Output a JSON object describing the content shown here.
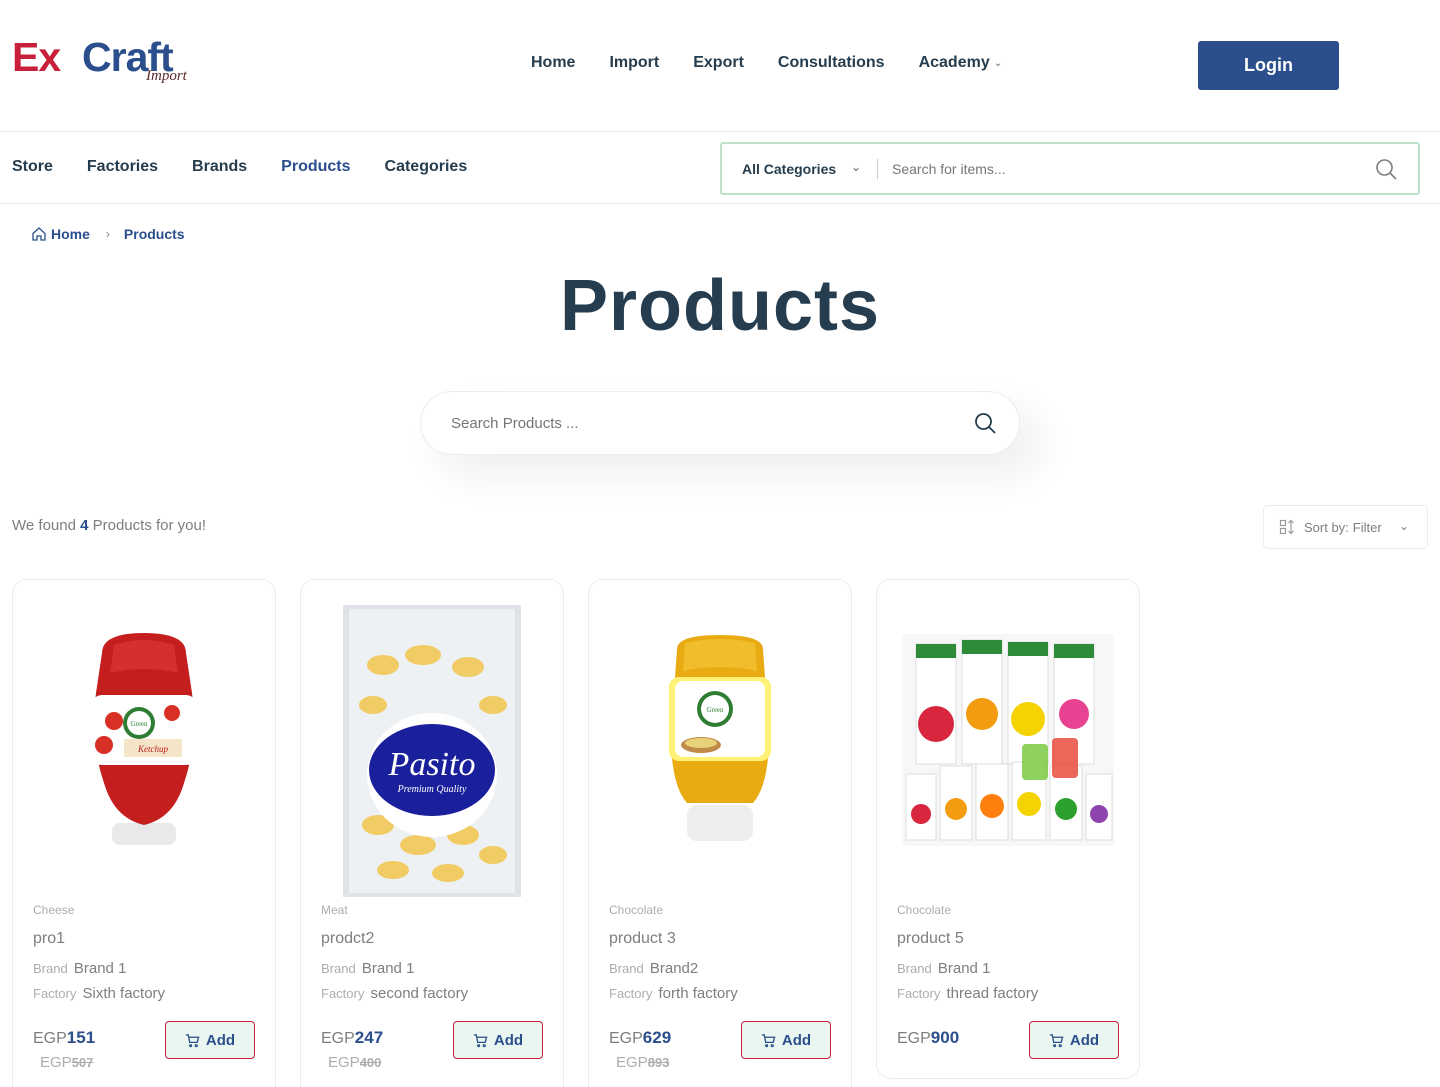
{
  "logo": {
    "ex": "Ex",
    "craft": "Craft",
    "sub": "Import"
  },
  "header": {
    "nav": [
      "Home",
      "Import",
      "Export",
      "Consultations",
      "Academy"
    ],
    "login_label": "Login"
  },
  "subnav": {
    "links": [
      "Store",
      "Factories",
      "Brands",
      "Products",
      "Categories"
    ],
    "active": "Products",
    "category_select": "All Categories",
    "search_placeholder": "Search for items..."
  },
  "breadcrumb": {
    "home": "Home",
    "current": "Products"
  },
  "page_title": "Products",
  "product_search_placeholder": "Search Products ...",
  "results": {
    "prefix": "We found",
    "count": "4",
    "suffix": "Products for you!"
  },
  "sort": {
    "label": "Sort by:",
    "value": "Filter"
  },
  "card_labels": {
    "brand": "Brand",
    "factory": "Factory",
    "currency": "EGP",
    "add": "Add"
  },
  "products": [
    {
      "category": "Cheese",
      "name": "pro1",
      "brand": "Brand 1",
      "factory": "Sixth factory",
      "price": "151",
      "old_price": "507",
      "image": "ketchup-bottle"
    },
    {
      "category": "Meat",
      "name": "prodct2",
      "brand": "Brand 1",
      "factory": "second factory",
      "price": "247",
      "old_price": "400",
      "image": "pasta-bag"
    },
    {
      "category": "Chocolate",
      "name": "product 3",
      "brand": "Brand2",
      "factory": "forth factory",
      "price": "629",
      "old_price": "893",
      "image": "mustard-bottle"
    },
    {
      "category": "Chocolate",
      "name": "product 5",
      "brand": "Brand 1",
      "factory": "thread factory",
      "price": "900",
      "old_price": "",
      "image": "juice-cartons"
    }
  ],
  "colors": {
    "brand_blue": "#2b4e8c",
    "brand_red": "#c8203a",
    "text_dark": "#253d4e",
    "muted": "#7e7e7e",
    "border_green": "#bce3c9"
  }
}
